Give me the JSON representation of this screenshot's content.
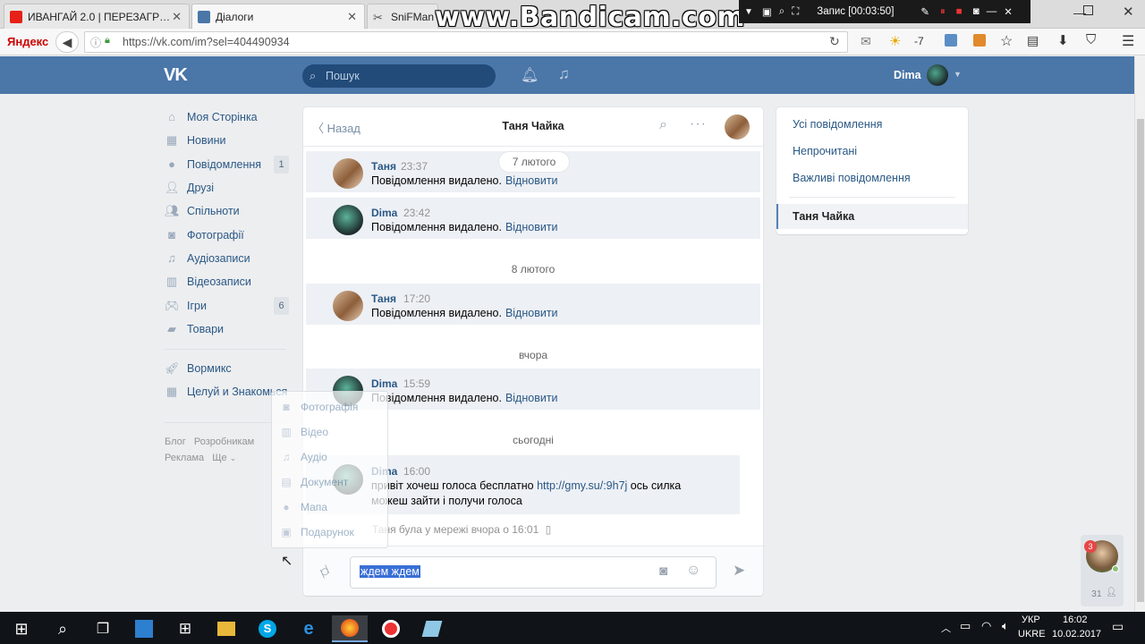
{
  "browser": {
    "tabs": [
      {
        "title": "ИВАНГАЙ 2.0 | ПЕРЕЗАГР…",
        "favicon_color": "#e62117"
      },
      {
        "title": "Діалоги",
        "favicon_color": "#4a76a8"
      },
      {
        "title": "SniFMan",
        "favicon_color": "#555555"
      }
    ],
    "brand": "Яндекс",
    "url": "https://vk.com/im?sel=404490934",
    "weather_temp": "-7"
  },
  "recorder": {
    "status": "Запис [00:03:50]",
    "watermark": "www.Bandicam.com"
  },
  "vk": {
    "logo": "VK",
    "search_placeholder": "Пошук",
    "user_name": "Dima",
    "nav": [
      {
        "label": "Моя Сторінка",
        "icon": "home-icon",
        "count": ""
      },
      {
        "label": "Новини",
        "icon": "news-icon",
        "count": ""
      },
      {
        "label": "Повідомлення",
        "icon": "messages-icon",
        "count": "1"
      },
      {
        "label": "Друзі",
        "icon": "friends-icon",
        "count": ""
      },
      {
        "label": "Спільноти",
        "icon": "communities-icon",
        "count": ""
      },
      {
        "label": "Фотографії",
        "icon": "camera-icon",
        "count": ""
      },
      {
        "label": "Аудіозаписи",
        "icon": "music-icon",
        "count": ""
      },
      {
        "label": "Відеозаписи",
        "icon": "video-icon",
        "count": ""
      },
      {
        "label": "Ігри",
        "icon": "games-icon",
        "count": "6"
      },
      {
        "label": "Товари",
        "icon": "shop-icon",
        "count": ""
      }
    ],
    "apps": [
      {
        "label": "Вормикс",
        "icon": "rocket-icon"
      },
      {
        "label": "Целуй и Знакомься",
        "icon": "apps-icon"
      }
    ],
    "footer": {
      "blog": "Блог",
      "devs": "Розробникам",
      "ads": "Реклама",
      "more": "Ще"
    }
  },
  "chat": {
    "back_label": "Назад",
    "title": "Таня Чайка",
    "date_badge": "7 лютого",
    "separators": [
      "8 лютого",
      "вчора",
      "сьогодні"
    ],
    "messages": [
      {
        "author": "Таня",
        "time": "23:37",
        "text": "Повідомлення видалено.",
        "action": "Відновити"
      },
      {
        "author": "Dima",
        "time": "23:42",
        "text": "Повідомлення видалено.",
        "action": "Відновити"
      },
      {
        "author": "Таня",
        "time": "17:20",
        "text": "Повідомлення видалено.",
        "action": "Відновити"
      },
      {
        "author": "Dima",
        "time": "15:59",
        "text": "Повідомлення видалено.",
        "action": "Відновити"
      }
    ],
    "last_message": {
      "author": "Dima",
      "time": "16:00",
      "text_before": "привіт хочеш голоса бесплатно ",
      "link": "http://gmy.su/:9h7j",
      "text_after": " ось силка",
      "line2": "можеш зайти і получи голоса"
    },
    "status_line": "Таня була у мережі вчора о 16:01",
    "input_value": "ждем ждем"
  },
  "attach_menu": [
    {
      "label": "Фотографія",
      "icon": "camera-icon"
    },
    {
      "label": "Відео",
      "icon": "video-icon"
    },
    {
      "label": "Аудіо",
      "icon": "music-icon"
    },
    {
      "label": "Документ",
      "icon": "document-icon"
    },
    {
      "label": "Мапа",
      "icon": "map-pin-icon"
    },
    {
      "label": "Подарунок",
      "icon": "gift-icon"
    }
  ],
  "right_menu": {
    "items": [
      "Усі повідомлення",
      "Непрочитані",
      "Важливі повідомлення"
    ],
    "active": "Таня Чайка"
  },
  "chat_bubble": {
    "badge": "3",
    "online_count": "31"
  },
  "taskbar": {
    "lang": "УКР",
    "layout": "UKRE",
    "time": "16:02",
    "date": "10.02.2017"
  }
}
